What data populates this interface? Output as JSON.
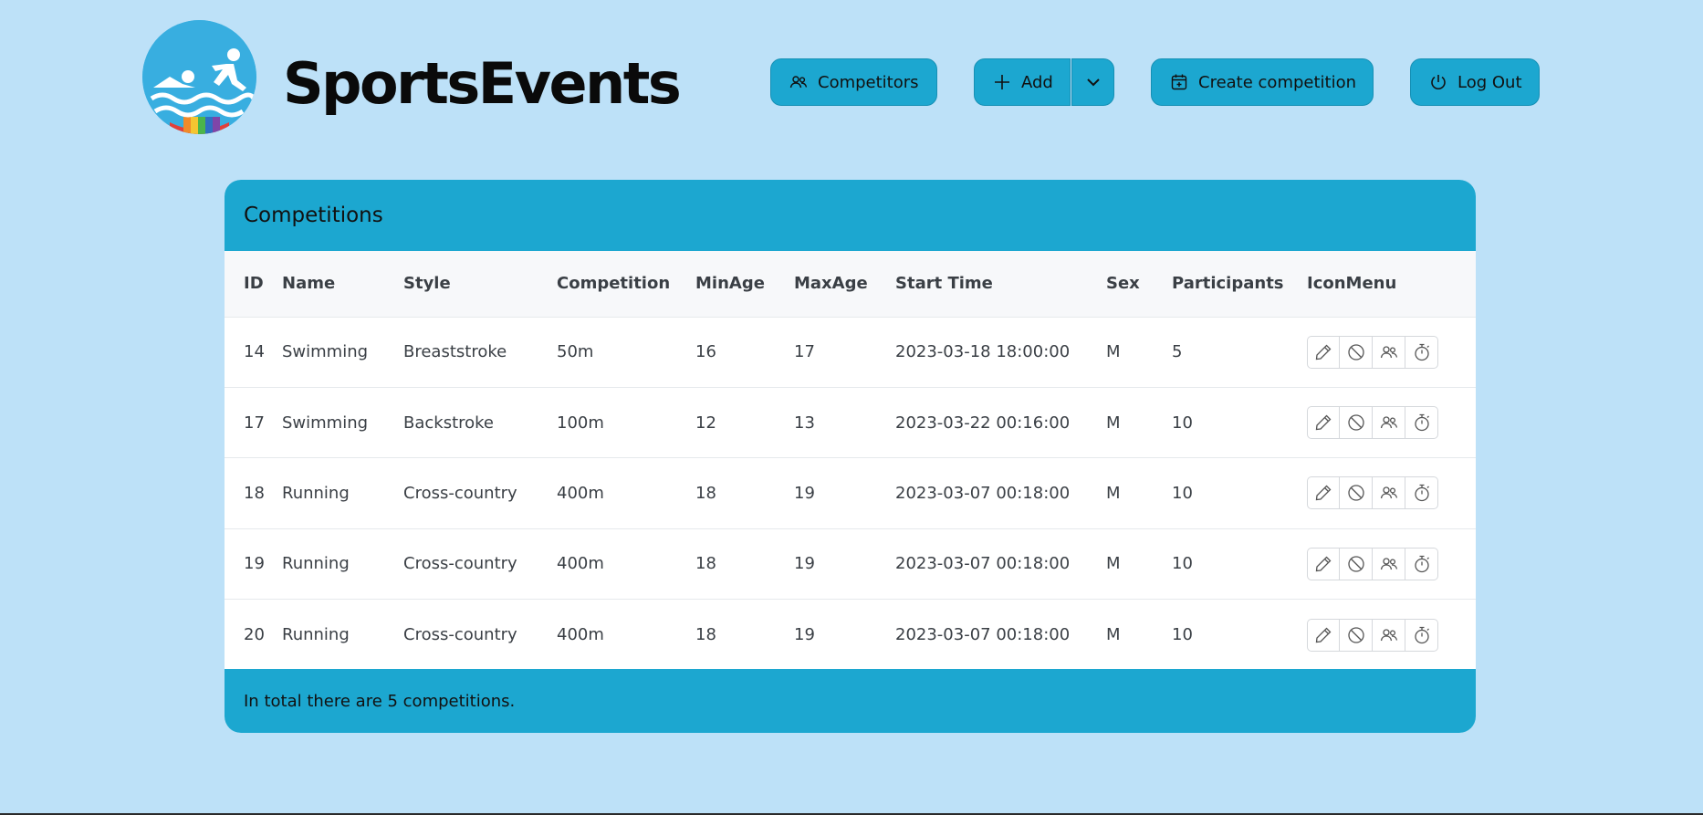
{
  "brand": {
    "name": "SportsEvents",
    "logo_icon": "swimmer-runner-logo"
  },
  "nav": {
    "competitors_label": "Competitors",
    "add_label": "Add",
    "create_label": "Create competition",
    "logout_label": "Log Out"
  },
  "card": {
    "title": "Competitions",
    "footer": "In total there are 5 competitions."
  },
  "table": {
    "columns": [
      "ID",
      "Name",
      "Style",
      "Competition",
      "MinAge",
      "MaxAge",
      "Start Time",
      "Sex",
      "Participants",
      "IconMenu"
    ],
    "rows": [
      {
        "id": "14",
        "name": "Swimming",
        "style": "Breaststroke",
        "competition": "50m",
        "min_age": "16",
        "max_age": "17",
        "start_time": "2023-03-18 18:00:00",
        "sex": "M",
        "participants": "5"
      },
      {
        "id": "17",
        "name": "Swimming",
        "style": "Backstroke",
        "competition": "100m",
        "min_age": "12",
        "max_age": "13",
        "start_time": "2023-03-22 00:16:00",
        "sex": "M",
        "participants": "10"
      },
      {
        "id": "18",
        "name": "Running",
        "style": "Cross-country",
        "competition": "400m",
        "min_age": "18",
        "max_age": "19",
        "start_time": "2023-03-07 00:18:00",
        "sex": "M",
        "participants": "10"
      },
      {
        "id": "19",
        "name": "Running",
        "style": "Cross-country",
        "competition": "400m",
        "min_age": "18",
        "max_age": "19",
        "start_time": "2023-03-07 00:18:00",
        "sex": "M",
        "participants": "10"
      },
      {
        "id": "20",
        "name": "Running",
        "style": "Cross-country",
        "competition": "400m",
        "min_age": "18",
        "max_age": "19",
        "start_time": "2023-03-07 00:18:00",
        "sex": "M",
        "participants": "10"
      }
    ],
    "row_icons": [
      "pencil-icon",
      "ban-icon",
      "people-icon",
      "stopwatch-icon"
    ]
  },
  "colors": {
    "background": "#bde1f8",
    "accent": "#1ca7d0",
    "table_header_bg": "#f7f8fa"
  }
}
